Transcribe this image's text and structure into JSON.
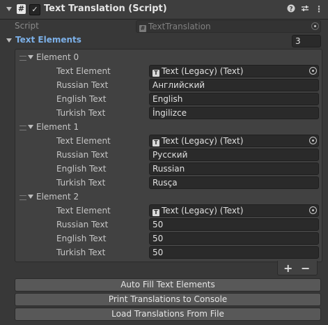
{
  "header": {
    "title": "Text Translation (Script)",
    "icons": [
      "help-icon",
      "presets-icon",
      "more-menu-icon"
    ],
    "enabled": true
  },
  "script_field": {
    "label": "Script",
    "value": "TextTranslation"
  },
  "array": {
    "label": "Text Elements",
    "count": "3",
    "elements": [
      {
        "title": "Element 0",
        "fields": [
          {
            "label": "Text Element",
            "value": "Text (Legacy) (Text)"
          },
          {
            "label": "Russian Text",
            "value": "Английский"
          },
          {
            "label": "English Text",
            "value": "English"
          },
          {
            "label": "Turkish Text",
            "value": "İngilizce"
          }
        ]
      },
      {
        "title": "Element 1",
        "fields": [
          {
            "label": "Text Element",
            "value": "Text (Legacy) (Text)"
          },
          {
            "label": "Russian Text",
            "value": "Русский"
          },
          {
            "label": "English Text",
            "value": "Russian"
          },
          {
            "label": "Turkish Text",
            "value": "Rusça"
          }
        ]
      },
      {
        "title": "Element 2",
        "fields": [
          {
            "label": "Text Element",
            "value": "Text (Legacy) (Text)"
          },
          {
            "label": "Russian Text",
            "value": "50"
          },
          {
            "label": "English Text",
            "value": "50"
          },
          {
            "label": "Turkish Text",
            "value": "50"
          }
        ]
      }
    ],
    "add_label": "+",
    "remove_label": "−"
  },
  "buttons": {
    "auto_fill": "Auto Fill Text Elements",
    "print": "Print Translations to Console",
    "load": "Load Translations From File"
  },
  "colors": {
    "background": "#383838",
    "header": "#3e3e3e",
    "field": "#2a2a2a",
    "accent_label": "#7cb0e8",
    "button": "#585858"
  }
}
